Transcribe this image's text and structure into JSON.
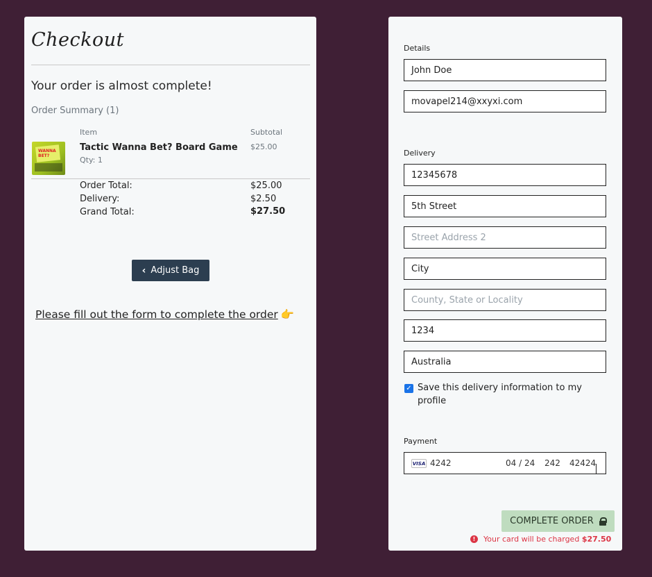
{
  "checkout": {
    "title": "Checkout",
    "almost_complete": "Your order is almost complete!",
    "order_summary": "Order Summary (1)",
    "item_header": "Item",
    "subtotal_header": "Subtotal",
    "product": {
      "name": "Tactic Wanna Bet? Board Game",
      "qty": "Qty: 1",
      "subtotal": "$25.00",
      "thumb_text": "WANNA BET?"
    },
    "order_total_label": "Order Total:",
    "order_total": "$25.00",
    "delivery_label": "Delivery:",
    "delivery": "$2.50",
    "grand_total_label": "Grand Total:",
    "grand_total": "$27.50",
    "adjust_bag": "Adjust Bag",
    "please_fill": "Please fill out the form to complete the order",
    "hand_glyph": "👉"
  },
  "form": {
    "details_label": "Details",
    "name": "John Doe",
    "email": "movapel214@xxyxi.com",
    "delivery_label": "Delivery",
    "phone": "12345678",
    "street1": "5th Street",
    "street2_placeholder": "Street Address 2",
    "city": "City",
    "county_placeholder": "County, State or Locality",
    "postcode": "1234",
    "country": "Australia",
    "save_info": "Save this delivery information to my profile",
    "payment_label": "Payment",
    "card": {
      "brand": "VISA",
      "number": "4242",
      "expiry": "04 / 24",
      "cvc": "242",
      "zip": "42424"
    },
    "complete_order": "COMPLETE ORDER",
    "charge_text": "Your card will be charged",
    "charge_amount": "$27.50"
  },
  "colors": {
    "background": "#3f1f35",
    "panel": "#f6f8f9",
    "button_dark": "#2c3e50",
    "button_green": "#bfdcbf",
    "error": "#dc3545",
    "checkbox": "#1a73e8"
  }
}
